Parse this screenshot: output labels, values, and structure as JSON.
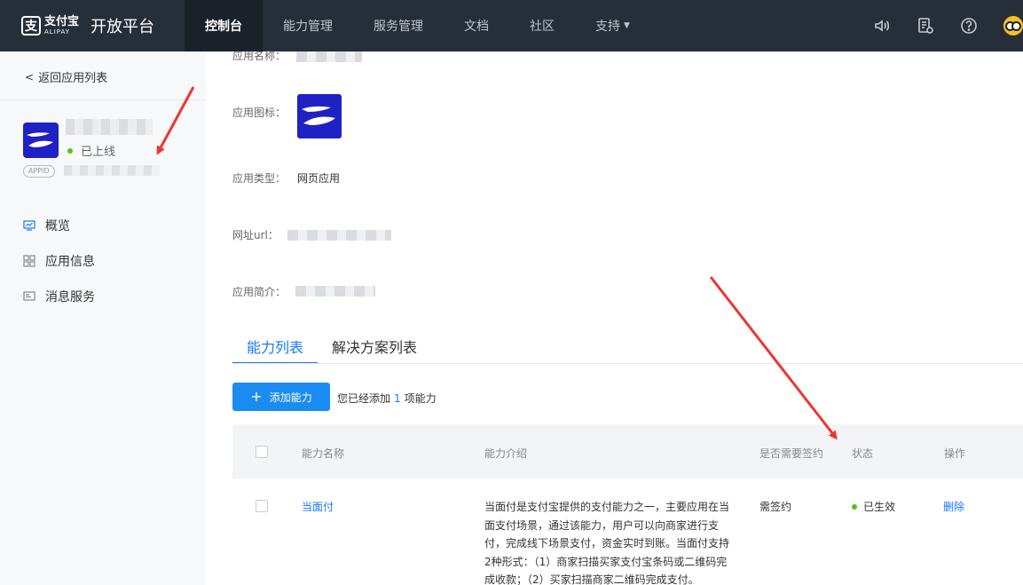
{
  "header": {
    "logo_cn": "支付宝",
    "logo_en": "ALIPAY",
    "title": "开放平台",
    "nav": [
      {
        "label": "控制台",
        "active": true
      },
      {
        "label": "能力管理"
      },
      {
        "label": "服务管理"
      },
      {
        "label": "文档"
      },
      {
        "label": "社区"
      },
      {
        "label": "支持"
      }
    ],
    "icons": [
      "speaker-icon",
      "notice-doc-icon",
      "help-icon",
      "user-avatar"
    ]
  },
  "sidebar": {
    "back_label": "返回应用列表",
    "app_status": "已上线",
    "appid_badge": "APPID",
    "menu": [
      {
        "label": "概览",
        "icon": "overview-monitor-icon"
      },
      {
        "label": "应用信息",
        "icon": "grid-apps-icon"
      },
      {
        "label": "消息服务",
        "icon": "message-service-icon"
      }
    ]
  },
  "main": {
    "fields": {
      "name_label": "应用名称：",
      "icon_label": "应用图标：",
      "type_label": "应用类型：",
      "type_value": "网页应用",
      "url_label": "网址url：",
      "intro_label": "应用简介："
    },
    "tabs": [
      {
        "label": "能力列表",
        "active": true
      },
      {
        "label": "解决方案列表"
      }
    ],
    "add_button": "添加能力",
    "added_prefix": "您已经添加",
    "added_count": "1",
    "added_suffix": "项能力",
    "table": {
      "headers": [
        "能力名称",
        "能力介绍",
        "是否需要签约",
        "状态",
        "操作"
      ],
      "rows": [
        {
          "name": "当面付",
          "description": "当面付是支付宝提供的支付能力之一，主要应用在当面支付场景，通过该能力，用户可以向商家进行支付，完成线下场景支付，资金实时到账。当面付支持2种形式：（1）商家扫描买家支付宝条码或二维码完成收款；（2）买家扫描商家二维码完成支付。",
          "sign": "需签约",
          "status": "已生效",
          "action": "删除"
        }
      ]
    }
  },
  "colors": {
    "topbar": "#262e39",
    "accent": "#1677ff",
    "button": "#1a8cf1",
    "status_green": "#52c41a",
    "annotation_red": "#f0342e"
  }
}
